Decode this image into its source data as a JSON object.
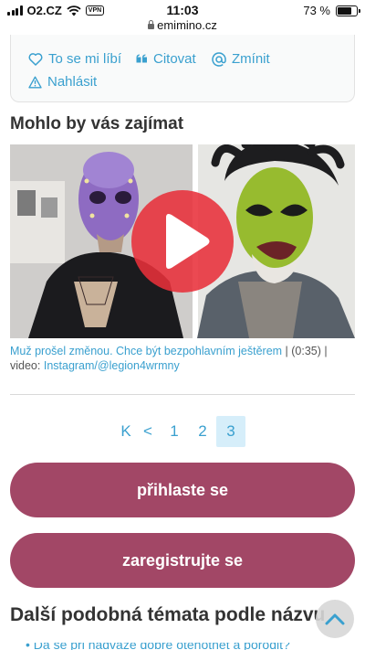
{
  "status_bar": {
    "carrier": "O2.CZ",
    "vpn": "VPN",
    "time": "11:03",
    "battery": "73 %",
    "battery_level": 0.73
  },
  "browser": {
    "url": "emimino.cz"
  },
  "post_actions": {
    "like_label": "To se mi líbí",
    "quote_label": "Citovat",
    "mention_label": "Zmínit",
    "report_label": "Nahlásit"
  },
  "recommended": {
    "title": "Mohlo by vás zajímat",
    "video_title": "Muž prošel změnou. Chce být bezpohlavním ještěrem",
    "duration": "| (0:35) |",
    "credit_prefix": "video: ",
    "credit_link": "Instagram/@legion4wrmny"
  },
  "pagination": {
    "first": "K",
    "prev": "<",
    "pages": [
      "1",
      "2",
      "3"
    ],
    "current": "3"
  },
  "buttons": {
    "login": "přihlaste se",
    "register": "zaregistrujte se"
  },
  "similar": {
    "title": "Další podobná témata podle názvu"
  },
  "colors": {
    "accent_link": "#3aa0cf",
    "primary_button": "#a24766",
    "play_button": "#e8303a"
  }
}
